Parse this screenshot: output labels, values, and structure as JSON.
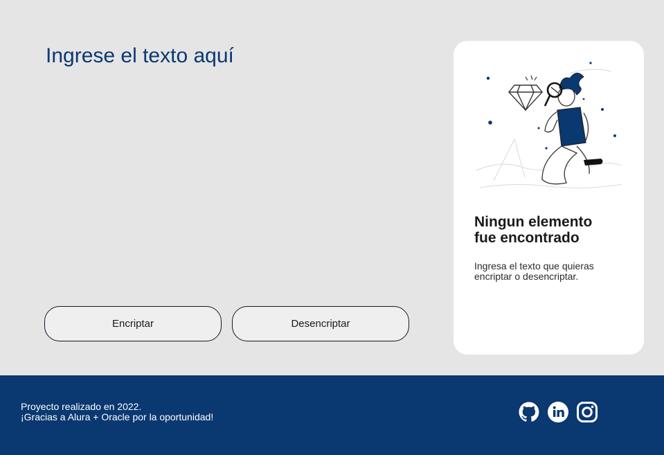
{
  "input": {
    "placeholder": "Ingrese el texto aquí"
  },
  "buttons": {
    "encrypt_label": "Encriptar",
    "decrypt_label": "Desencriptar"
  },
  "result_card": {
    "title_line1": "Ningun elemento",
    "title_line2": "fue encontrado",
    "description_line1": "Ingresa el texto que quieras",
    "description_line2": "encriptar o desencriptar."
  },
  "footer": {
    "line1": "Proyecto realizado en 2022.",
    "line2": "¡Gracias a Alura + Oracle por la oportunidad!",
    "social": [
      "github-icon",
      "linkedin-icon",
      "instagram-icon"
    ]
  },
  "colors": {
    "background": "#e5e5e5",
    "accent": "#0a3871",
    "card": "#ffffff",
    "button_bg": "#efefef"
  }
}
